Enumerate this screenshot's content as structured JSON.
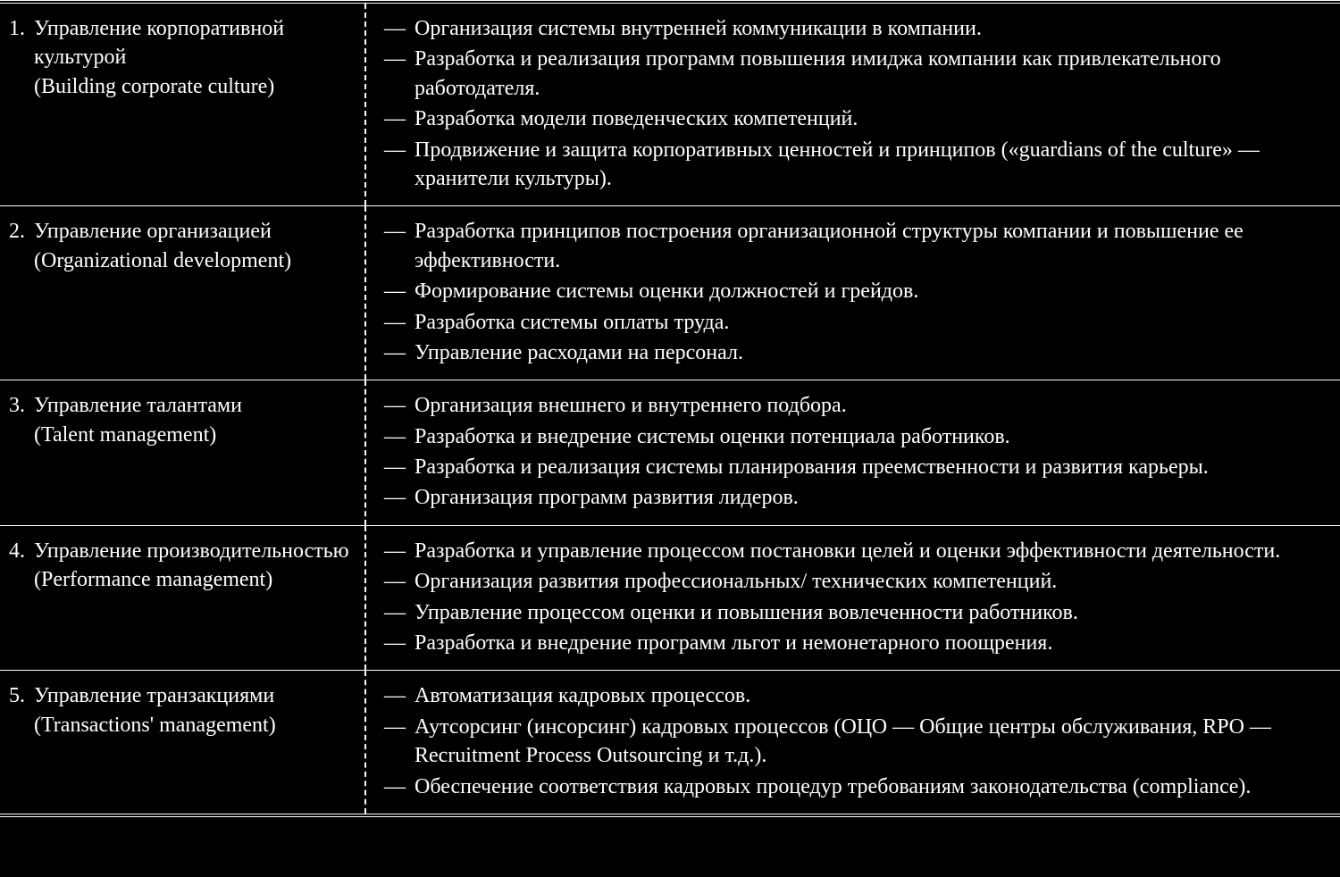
{
  "dash": "—",
  "rows": [
    {
      "num": "1.",
      "title_ru": "Управление корпоративной культурой",
      "title_en": "(Building corporate culture)",
      "bullets": [
        "Организация системы внутренней коммуникации в компании.",
        "Разработка и реализация программ повышения имиджа компании как привлекательного работодателя.",
        "Разработка модели поведенческих компетенций.",
        "Продвижение и защита корпоративных ценностей и принципов («guardians of the culture» — хранители культуры)."
      ]
    },
    {
      "num": "2.",
      "title_ru": "Управление организацией",
      "title_en": "(Organizational development)",
      "bullets": [
        "Разработка принципов построения организационной структуры компании и повышение ее эффективности.",
        "Формирование системы оценки должностей и грейдов.",
        "Разработка системы оплаты труда.",
        "Управление расходами на персонал."
      ]
    },
    {
      "num": "3.",
      "title_ru": "Управление талантами",
      "title_en": "(Talent management)",
      "bullets": [
        "Организация внешнего и внутреннего подбора.",
        "Разработка и внедрение системы оценки потенциала работников.",
        "Разработка и реализация системы планирования преемственности и развития карьеры.",
        "Организация программ развития лидеров."
      ]
    },
    {
      "num": "4.",
      "title_ru": "Управление производительностью",
      "title_en": "(Performance management)",
      "bullets": [
        "Разработка и управление процессом постановки целей и оценки эффективности деятельности.",
        "Организация развития профессиональных/ технических компетенций.",
        "Управление процессом оценки и повышения вовлеченности работников.",
        "Разработка и внедрение программ льгот и немонетарного поощрения."
      ]
    },
    {
      "num": "5.",
      "title_ru": "Управление транзакциями",
      "title_en": "(Transactions' management)",
      "bullets": [
        "Автоматизация кадровых процессов.",
        "Аутсорсинг (инсорсинг) кадровых процессов (ОЦО — Общие центры обслуживания, RPO — Recruitment Process Outsourcing и т.д.).",
        "Обеспечение соответствия кадровых процедур требованиям законодательства (compliance)."
      ]
    }
  ]
}
